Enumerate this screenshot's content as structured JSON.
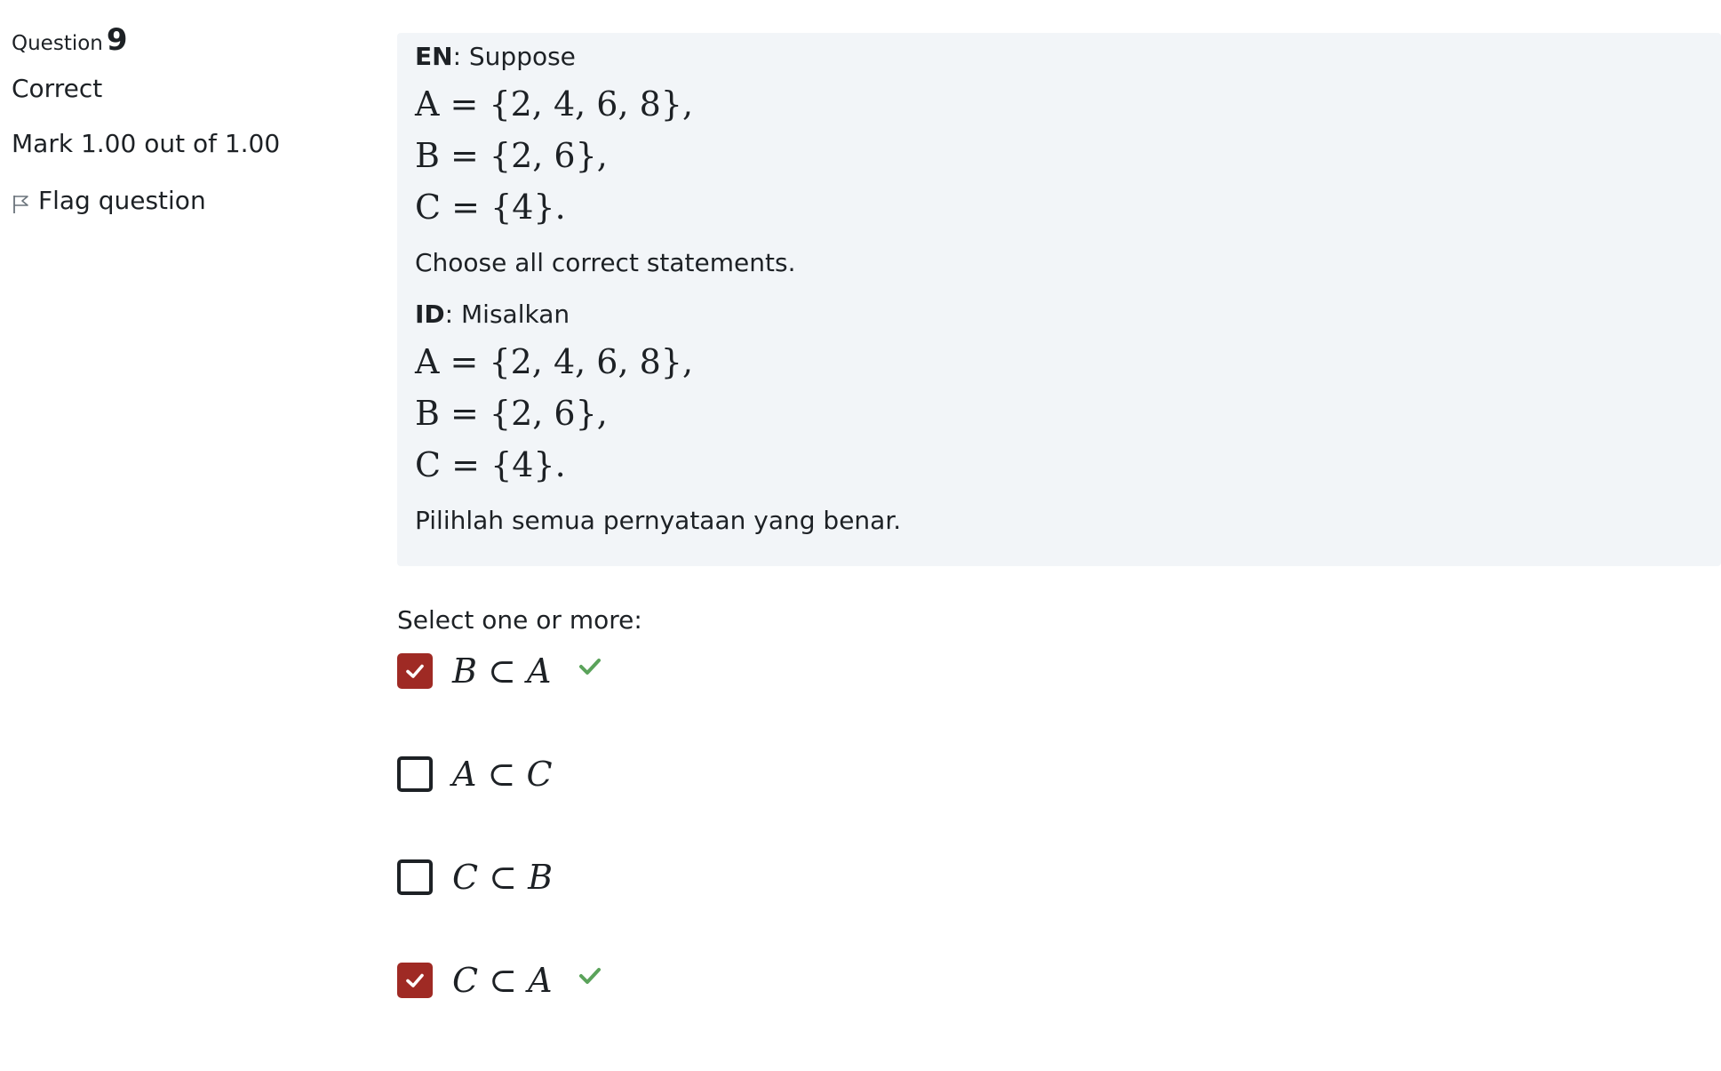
{
  "info": {
    "question_word": "Question",
    "question_number": "9",
    "state": "Correct",
    "grade": "Mark 1.00 out of 1.00",
    "flag_label": "Flag question",
    "flag_icon": "flag-icon"
  },
  "qtext": {
    "en_tag": "EN",
    "en_intro": ": Suppose",
    "en_sets": [
      "A = {2, 4, 6, 8},",
      "B = {2, 6},",
      "C = {4}."
    ],
    "en_instruction": "Choose all correct statements.",
    "id_tag": "ID",
    "id_intro": ": Misalkan",
    "id_sets": [
      "A = {2, 4, 6, 8},",
      "B = {2, 6},",
      "C = {4}."
    ],
    "id_instruction": "Pilihlah semua pernyataan yang benar."
  },
  "answer": {
    "prompt": "Select one or more:",
    "options": [
      {
        "left": "B",
        "op": "⊂",
        "right": "A",
        "checked": true,
        "feedback": "correct-check-icon"
      },
      {
        "left": "A",
        "op": "⊂",
        "right": "C",
        "checked": false,
        "feedback": ""
      },
      {
        "left": "C",
        "op": "⊂",
        "right": "B",
        "checked": false,
        "feedback": ""
      },
      {
        "left": "C",
        "op": "⊂",
        "right": "A",
        "checked": true,
        "feedback": "correct-check-icon"
      }
    ]
  },
  "colors": {
    "checkbox_checked": "#9f2a24",
    "correct_mark": "#5ba35b",
    "qtext_background": "#f2f5f8"
  }
}
